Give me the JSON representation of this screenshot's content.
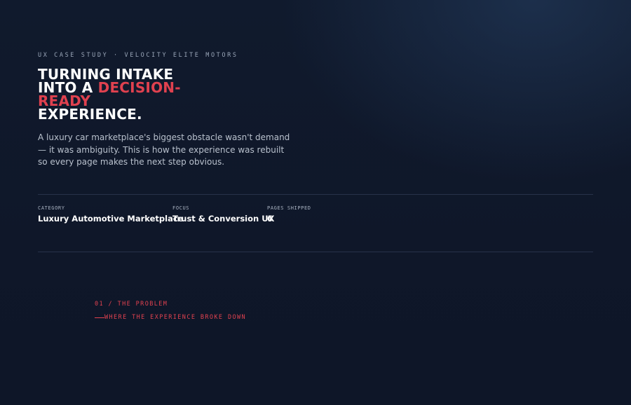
{
  "hero": {
    "eyebrow": "UX CASE STUDY · VELOCITY ELITE MOTORS",
    "headline": {
      "line1": "TURNING INTAKE",
      "line2_prefix": "INTO A ",
      "line2_accent": "DECISION-",
      "line3_accent": "READY",
      "line4": "EXPERIENCE."
    },
    "lede": "A luxury car marketplace's biggest obstacle wasn't demand — it was ambiguity. This is how the experience was rebuilt so every page makes the next step obvious."
  },
  "meta": [
    {
      "label": "CATEGORY",
      "value": "Luxury Automotive Marketplace"
    },
    {
      "label": "FOCUS",
      "value": "Trust & Conversion UX"
    },
    {
      "label": "PAGES SHIPPED",
      "value": "6"
    }
  ],
  "section": {
    "number": "01 / THE PROBLEM",
    "subtitle": "WHERE THE EXPERIENCE BROKE DOWN"
  },
  "colors": {
    "background": "#0f1729",
    "accent": "#e0414f",
    "text": "#ffffff",
    "muted": "#b9c1cd",
    "divider": "#27324a"
  }
}
